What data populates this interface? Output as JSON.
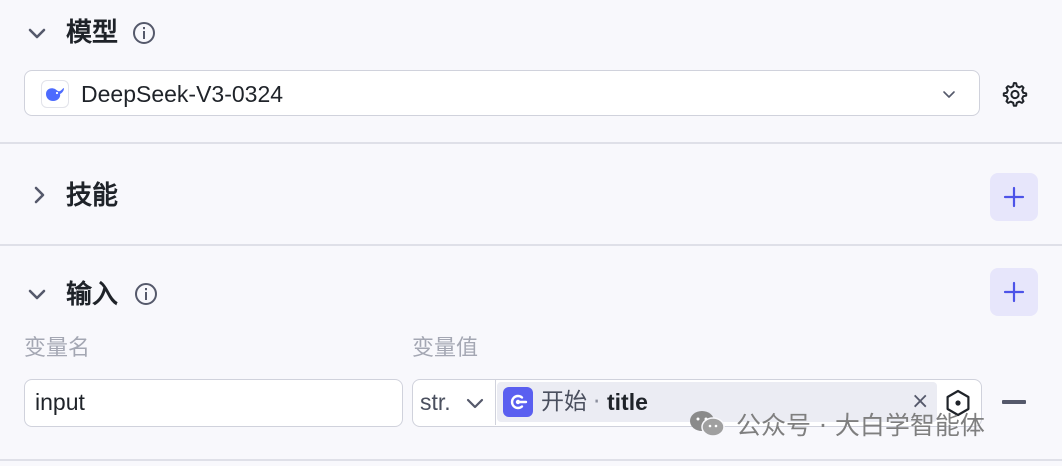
{
  "model_section": {
    "title": "模型",
    "selected_model": "DeepSeek-V3-0324"
  },
  "skills_section": {
    "title": "技能"
  },
  "input_section": {
    "title": "输入",
    "col_name_label": "变量名",
    "col_value_label": "变量值",
    "rows": [
      {
        "name": "input",
        "type": "str.",
        "ref_node": "开始",
        "ref_separator": "·",
        "ref_variable": "title",
        "clear_label": "×"
      }
    ]
  },
  "watermark": {
    "text": "公众号 · 大白学智能体"
  },
  "colors": {
    "accent": "#4d53e8",
    "accent_bg": "#e7e6fb",
    "border": "#d0d2dc",
    "background": "#f8f8fc"
  }
}
